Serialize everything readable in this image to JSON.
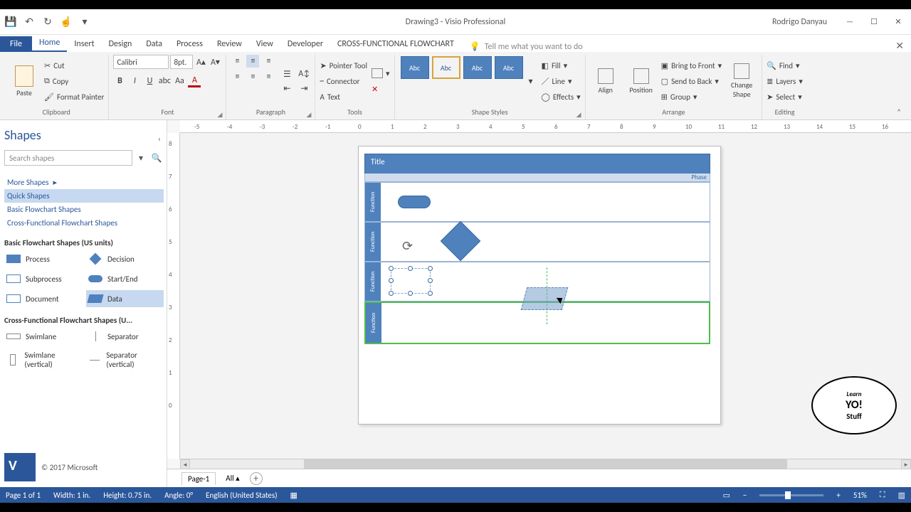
{
  "title": "Drawing3  -  Visio Professional",
  "user": "Rodrigo Danyau",
  "tabs": {
    "file": "File",
    "home": "Home",
    "insert": "Insert",
    "design": "Design",
    "data": "Data",
    "process": "Process",
    "review": "Review",
    "view": "View",
    "developer": "Developer",
    "cff": "CROSS-FUNCTIONAL FLOWCHART"
  },
  "tellme": "Tell me what you want to do",
  "ribbon": {
    "clipboard": {
      "label": "Clipboard",
      "paste": "Paste",
      "cut": "Cut",
      "copy": "Copy",
      "format_painter": "Format Painter"
    },
    "font": {
      "label": "Font",
      "name": "Calibri",
      "size": "8pt."
    },
    "paragraph": {
      "label": "Paragraph"
    },
    "tools": {
      "label": "Tools",
      "pointer": "Pointer Tool",
      "connector": "Connector",
      "text": "Text"
    },
    "styles": {
      "label": "Shape Styles",
      "swatch": "Abc",
      "fill": "Fill",
      "line": "Line",
      "effects": "Effects"
    },
    "arrange": {
      "label": "Arrange",
      "align": "Align",
      "position": "Position",
      "bring": "Bring to Front",
      "send": "Send to Back",
      "group": "Group",
      "change": "Change Shape"
    },
    "editing": {
      "label": "Editing",
      "find": "Find",
      "layers": "Layers",
      "select": "Select"
    }
  },
  "shapes_panel": {
    "title": "Shapes",
    "search_placeholder": "Search shapes",
    "more": "More Shapes",
    "categories": {
      "quick": "Quick Shapes",
      "basic": "Basic Flowchart Shapes",
      "cross": "Cross-Functional Flowchart Shapes"
    },
    "basic_hdr": "Basic Flowchart Shapes (US units)",
    "shapes": {
      "process": "Process",
      "decision": "Decision",
      "subprocess": "Subprocess",
      "startend": "Start/End",
      "document": "Document",
      "data": "Data"
    },
    "cross_hdr": "Cross-Functional Flowchart Shapes (U...",
    "cross_shapes": {
      "swimlane": "Swimlane",
      "separator": "Separator",
      "swimlane_v": "Swimlane (vertical)",
      "separator_v": "Separator (vertical)"
    },
    "copyright": "© 2017 Microsoft"
  },
  "canvas": {
    "title": "Title",
    "phase": "Phase",
    "function": "Function"
  },
  "pagetabs": {
    "page1": "Page-1",
    "all": "All"
  },
  "status": {
    "pages": "Page 1 of 1",
    "width": "Width: 1 in.",
    "height": "Height: 0.75 in.",
    "angle": "Angle: 0°",
    "lang": "English (United States)",
    "zoom": "51%"
  },
  "ruler_ticks": [
    "-5",
    "-4",
    "-3",
    "-2",
    "-1",
    "0",
    "1",
    "2",
    "3",
    "4",
    "5",
    "6",
    "7",
    "8",
    "9",
    "10",
    "11",
    "12",
    "13",
    "14",
    "15",
    "16"
  ],
  "vruler_ticks": [
    "8",
    "7",
    "6",
    "5",
    "4",
    "3",
    "2",
    "1",
    "0"
  ],
  "yo": {
    "l1": "Learn",
    "l2": "YO!",
    "l3": "Stuff"
  }
}
